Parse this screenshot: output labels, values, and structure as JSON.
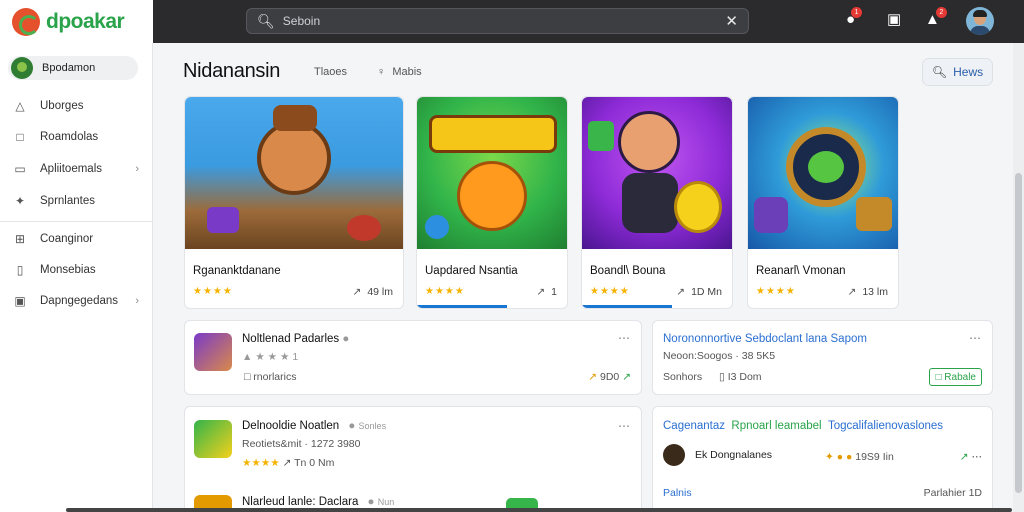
{
  "header": {
    "logo_text": "dpoakar",
    "search_placeholder": "Seboin",
    "notification_badge_1": "1",
    "notification_badge_2": "2"
  },
  "sidebar": {
    "user_label": "Bpodamon",
    "items": [
      {
        "label": "Uborges",
        "icon": "bulb-icon"
      },
      {
        "label": "Roamdolas",
        "icon": "book-icon"
      },
      {
        "label": "Apliitoemals",
        "icon": "window-icon",
        "has_chevron": true
      },
      {
        "label": "Sprnlantes",
        "icon": "settings-icon"
      },
      {
        "label": "Coanginor",
        "icon": "grid-icon"
      },
      {
        "label": "Monsebias",
        "icon": "bookmark-icon"
      },
      {
        "label": "Dapngegedans",
        "icon": "target-icon",
        "has_chevron": true
      }
    ]
  },
  "main": {
    "title": "Nidanansin",
    "tabs": [
      {
        "label": "Tlaoes",
        "icon": "tag-icon"
      },
      {
        "label": "Mabis",
        "icon": "user-icon"
      }
    ],
    "news_button": "Hews"
  },
  "games": [
    {
      "name": "Rgananktdanane",
      "stars": "★★★★",
      "meta": "49 lm",
      "colors": [
        "#3b9be0",
        "#8b5a2b"
      ],
      "progress": 0
    },
    {
      "name": "Uapdared Nsantia",
      "stars": "★★★★",
      "meta": "1",
      "colors": [
        "#31b44a",
        "#ff9a1f"
      ],
      "progress": 0.6
    },
    {
      "name": "Boandl\\ Bouna",
      "stars": "★★★★",
      "meta": "1D Mn",
      "colors": [
        "#8e2bd8",
        "#f5d11c"
      ],
      "progress": 0.6
    },
    {
      "name": "Reanarl\\ Vmonan",
      "stars": "★★★★",
      "meta": "13 lm",
      "colors": [
        "#1d7fd6",
        "#55c542"
      ],
      "progress": 0
    }
  ],
  "feed": {
    "item1": {
      "title": "Noltlenad Padarles",
      "rating": "★ ★ ★ 1",
      "sub": "rnorlarics",
      "right_value": "9D0"
    },
    "item2": {
      "title": "Delnooldie Noatlen",
      "title_extra": "Sonles",
      "line2": "Reotiets&mit · 1272 3980",
      "stars": "★★★★",
      "meta": "Tn 0 Nm"
    },
    "item3": {
      "title": "Nlarleud lanle: Daclara",
      "title_extra": "Nun"
    },
    "news1": {
      "title": "Norononnortive Sebdoclant lana Sapom",
      "line2": "Neoon:Soogos · 38 5K5",
      "sub1": "Sonhors",
      "sub2": "I3 Dom",
      "button": "Rabale"
    },
    "news2": {
      "title_a": "Cagenantaz",
      "title_b": "Rpnoarl leamabel",
      "title_c": "Togcalifalienovaslones",
      "user": "Ek Dongnalanes",
      "meta": "19S9 Iin",
      "foot_left": "Palnis",
      "foot_right": "Parlahier 1D"
    }
  },
  "colors": {
    "accent": "#2a6fd1",
    "brand": "#2aa34a",
    "star": "#f5b301"
  }
}
